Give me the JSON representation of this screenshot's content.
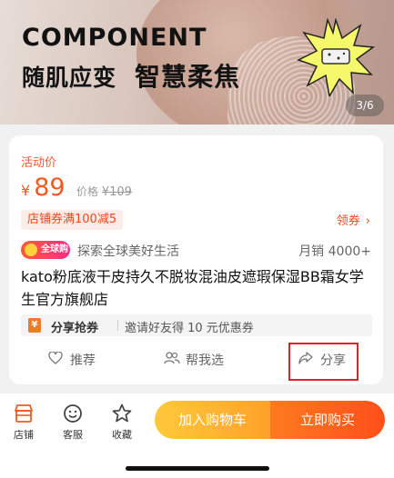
{
  "banner": {
    "title_en": "COMPONENT",
    "title_cn_left": "随肌应变",
    "title_cn_right": "智慧柔焦",
    "pager": "3/6"
  },
  "product": {
    "price_label": "活动价",
    "currency": "¥",
    "price": "89",
    "orig_label": "价格",
    "orig_price": "¥109",
    "coupon": "店铺券满100减5",
    "get_coupon": "领券",
    "global_badge": "全球购",
    "global_text": "探索全球美好生活",
    "sales": "月销 4000+",
    "title": "kato粉底液干皮持久不脱妆混油皮遮瑕保湿BB霜女学生官方旗舰店"
  },
  "share_bar": {
    "label": "分享抢券",
    "desc": "邀请好友得 10 元优惠券"
  },
  "actions": {
    "recommend": "推荐",
    "help_pick": "帮我选",
    "share": "分享"
  },
  "bottom": {
    "store": "店铺",
    "service": "客服",
    "favorite": "收藏",
    "add_cart": "加入购物车",
    "buy_now": "立即购买"
  },
  "colors": {
    "accent": "#f25a22",
    "highlight_box": "#e0212a",
    "cart_btn": "#ffb02e",
    "buy_btn": "#ff5a1b"
  }
}
